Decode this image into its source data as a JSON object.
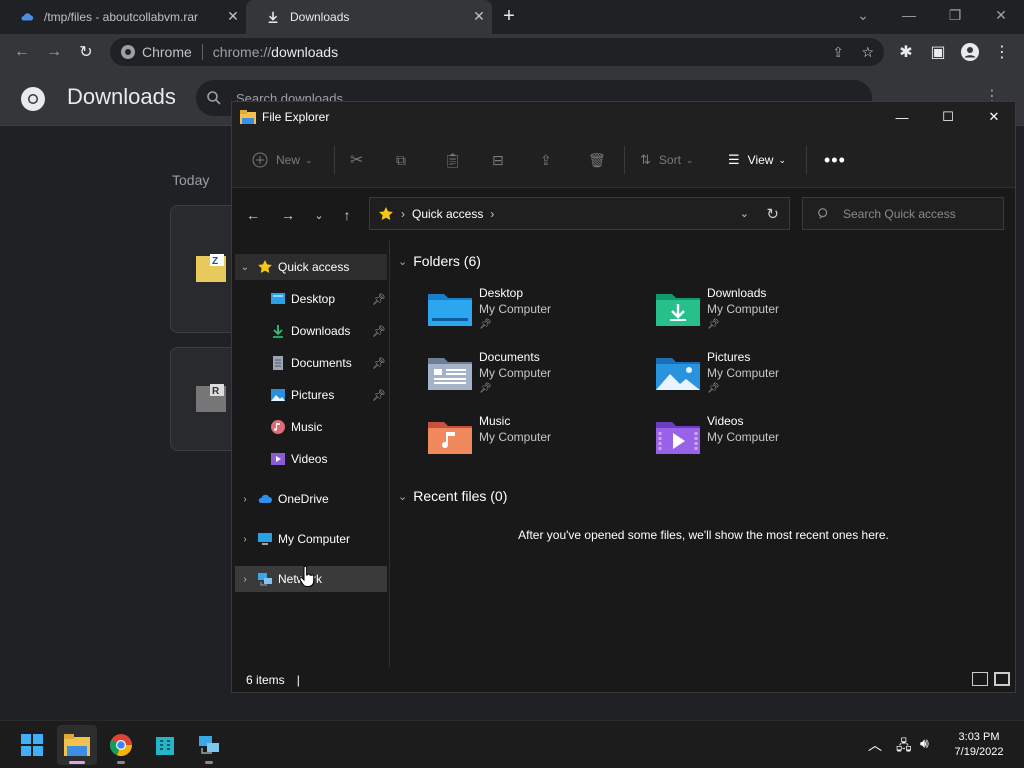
{
  "browser": {
    "tabs": [
      {
        "title": "/tmp/files - aboutcollabvm.rar"
      },
      {
        "title": "Downloads"
      }
    ],
    "omnibox": {
      "chip": "Chrome",
      "url_scheme": "chrome://",
      "url_host": "downloads"
    }
  },
  "downloads_page": {
    "title": "Downloads",
    "search_placeholder": "Search downloads",
    "date_group": "Today"
  },
  "explorer": {
    "title": "File Explorer",
    "commands": {
      "new": "New",
      "sort": "Sort",
      "view": "View"
    },
    "address": {
      "location": "Quick access"
    },
    "search_placeholder": "Search Quick access",
    "nav": {
      "quick_access": "Quick access",
      "items": [
        {
          "label": "Desktop",
          "pinned": true
        },
        {
          "label": "Downloads",
          "pinned": true
        },
        {
          "label": "Documents",
          "pinned": true
        },
        {
          "label": "Pictures",
          "pinned": true
        },
        {
          "label": "Music",
          "pinned": false
        },
        {
          "label": "Videos",
          "pinned": false
        }
      ],
      "onedrive": "OneDrive",
      "my_computer": "My Computer",
      "network": "Network"
    },
    "folders_header": "Folders (6)",
    "folders": [
      {
        "name": "Desktop",
        "location": "My Computer",
        "pinned": true
      },
      {
        "name": "Downloads",
        "location": "My Computer",
        "pinned": true
      },
      {
        "name": "Documents",
        "location": "My Computer",
        "pinned": true
      },
      {
        "name": "Pictures",
        "location": "My Computer",
        "pinned": true
      },
      {
        "name": "Music",
        "location": "My Computer",
        "pinned": false
      },
      {
        "name": "Videos",
        "location": "My Computer",
        "pinned": false
      }
    ],
    "recent_header": "Recent files (0)",
    "recent_empty": "After you've opened some files, we'll show the most recent ones here.",
    "status": "6 items"
  },
  "taskbar": {
    "time": "3:03 PM",
    "date": "7/19/2022"
  }
}
